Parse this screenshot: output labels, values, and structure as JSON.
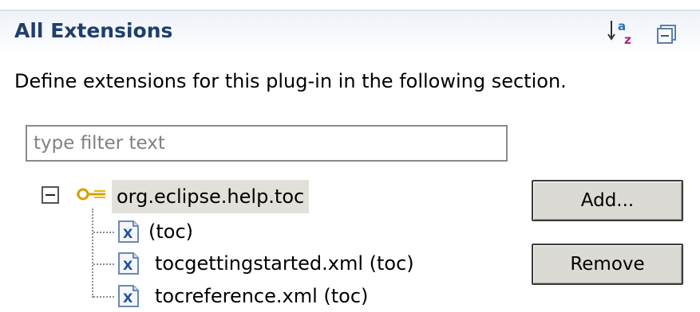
{
  "section": {
    "title": "All Extensions",
    "description": "Define extensions for this plug-in in the following section."
  },
  "toolbar": {
    "sort_icon": "sort-alphabetically-icon",
    "collapse_icon": "collapse-all-icon"
  },
  "filter": {
    "placeholder": "type filter text",
    "value": ""
  },
  "tree": {
    "root": {
      "label": "org.eclipse.help.toc",
      "icon": "extension-point-icon",
      "expanded": true,
      "selected": true
    },
    "children": [
      {
        "label": " (toc)",
        "icon": "xml-file-icon"
      },
      {
        "label": "tocgettingstarted.xml (toc)",
        "icon": "xml-file-icon"
      },
      {
        "label": "tocreference.xml (toc)",
        "icon": "xml-file-icon"
      }
    ]
  },
  "buttons": {
    "add_label": "Add...",
    "remove_label": "Remove"
  },
  "colors": {
    "title": "#1f3e6e",
    "selection": "#e2e0db",
    "button_face": "#dcdad5"
  }
}
